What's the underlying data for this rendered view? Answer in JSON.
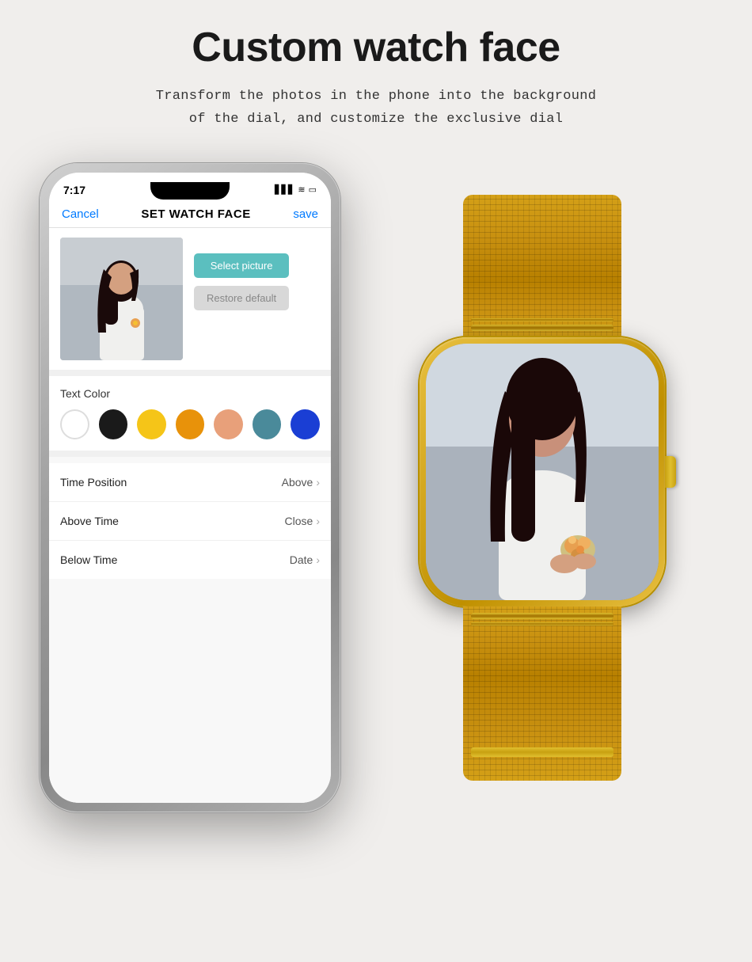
{
  "page": {
    "title": "Custom watch face",
    "subtitle_line1": "Transform the photos in the phone into the background",
    "subtitle_line2": "of the dial, and customize the exclusive dial"
  },
  "phone": {
    "status_bar": {
      "time": "7:17",
      "signal": "▋▋▋",
      "wifi": "WiFi",
      "battery": "🔋"
    },
    "header": {
      "cancel": "Cancel",
      "title": "SET WATCH FACE",
      "save": "save"
    },
    "photo_section": {
      "select_picture": "Select picture",
      "restore_default": "Restore default"
    },
    "text_color": {
      "label": "Text Color",
      "colors": [
        "white",
        "black",
        "yellow",
        "orange",
        "peach",
        "teal",
        "blue"
      ]
    },
    "settings": [
      {
        "label": "Time Position",
        "value": "Above",
        "has_chevron": true
      },
      {
        "label": "Above Time",
        "value": "Close",
        "has_chevron": true
      },
      {
        "label": "Below Time",
        "value": "Date",
        "has_chevron": true
      }
    ]
  },
  "icons": {
    "chevron": "›",
    "signal": "▋▋▋",
    "wifi": "≋",
    "battery": "▭"
  }
}
